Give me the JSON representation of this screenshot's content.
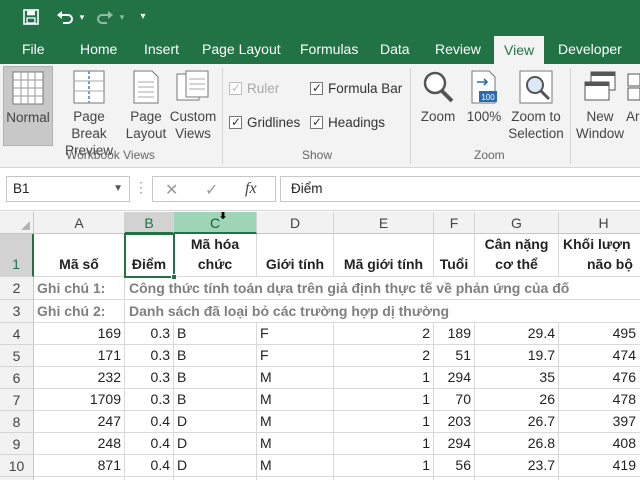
{
  "qat": {
    "save_icon": "save-icon",
    "undo_icon": "undo-icon",
    "redo_icon": "redo-icon",
    "customize_icon": "customize-qat-icon"
  },
  "tabs": [
    {
      "label": "File"
    },
    {
      "label": "Home"
    },
    {
      "label": "Insert"
    },
    {
      "label": "Page Layout"
    },
    {
      "label": "Formulas"
    },
    {
      "label": "Data"
    },
    {
      "label": "Review"
    },
    {
      "label": "View"
    },
    {
      "label": "Developer"
    }
  ],
  "ribbon": {
    "workbook_views": {
      "label": "Workbook Views",
      "normal": "Normal",
      "page_break_1": "Page Break",
      "page_break_2": "Preview",
      "page_layout_1": "Page",
      "page_layout_2": "Layout",
      "custom_1": "Custom",
      "custom_2": "Views"
    },
    "show": {
      "label": "Show",
      "ruler": "Ruler",
      "gridlines": "Gridlines",
      "formula_bar": "Formula Bar",
      "headings": "Headings"
    },
    "zoom": {
      "label": "Zoom",
      "zoom": "Zoom",
      "hundred": "100%",
      "hundred_icon_text": "100",
      "zoom_sel_1": "Zoom to",
      "zoom_sel_2": "Selection"
    },
    "window": {
      "new_1": "New",
      "new_2": "Window",
      "arrange_1": "Ar"
    }
  },
  "formula_bar": {
    "name_box": "B1",
    "fx": "fx",
    "content": "Điểm"
  },
  "columns": [
    "A",
    "B",
    "C",
    "D",
    "E",
    "F",
    "G",
    "H"
  ],
  "rows": [
    "1",
    "2",
    "3",
    "4",
    "5",
    "6",
    "7",
    "8",
    "9",
    "10"
  ],
  "header_row": {
    "a": "Mã số",
    "b": "Điểm",
    "c1": "Mã hóa",
    "c2": "chức",
    "d": "Giới tính",
    "e": "Mã giới tính",
    "f": "Tuổi",
    "g1": "Cân nặng",
    "g2": "cơ thể",
    "h1": "Khối lượn",
    "h2": "não bộ"
  },
  "notes": [
    {
      "label": "Ghi chú 1:",
      "text": "Công thức tính toán dựa trên giả định thực tế về phản ứng của đố"
    },
    {
      "label": "Ghi chú 2:",
      "text": "Danh sách đã loại bỏ các trường hợp dị thường"
    }
  ],
  "data_rows": [
    [
      "169",
      "0.3",
      "B",
      "F",
      "2",
      "189",
      "29.4",
      "495"
    ],
    [
      "171",
      "0.3",
      "B",
      "F",
      "2",
      "51",
      "19.7",
      "474"
    ],
    [
      "232",
      "0.3",
      "B",
      "M",
      "1",
      "294",
      "35",
      "476"
    ],
    [
      "1709",
      "0.3",
      "B",
      "M",
      "1",
      "70",
      "26",
      "478"
    ],
    [
      "247",
      "0.4",
      "D",
      "M",
      "1",
      "203",
      "26.7",
      "397"
    ],
    [
      "248",
      "0.4",
      "D",
      "M",
      "1",
      "294",
      "26.8",
      "408"
    ],
    [
      "871",
      "0.4",
      "D",
      "M",
      "1",
      "56",
      "23.7",
      "419"
    ]
  ],
  "colors": {
    "accent": "#217346",
    "selected_column_header": "#9fd5b7"
  }
}
